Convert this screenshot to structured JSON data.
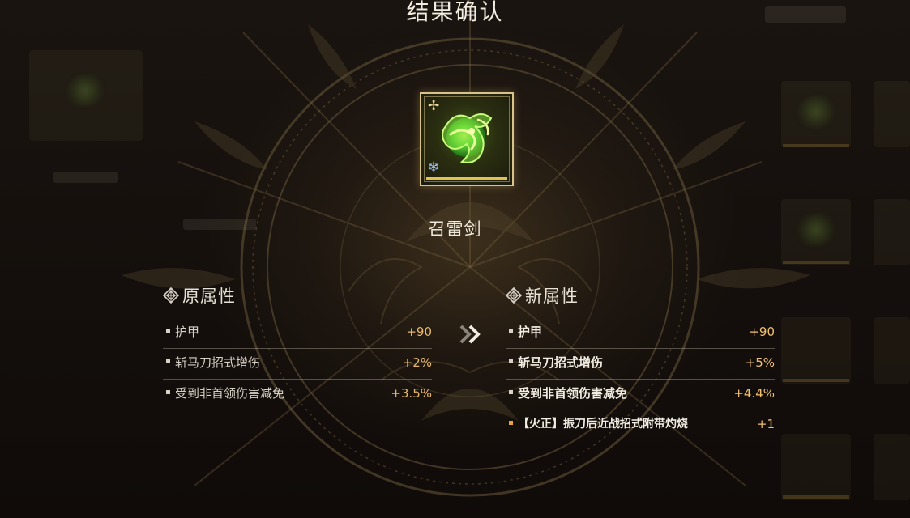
{
  "title": "结果确认",
  "item": {
    "name": "召雷剑",
    "icon": "green-serpent-gem-icon",
    "corner_top_left_icon": "cross-star-icon",
    "corner_bottom_left_icon": "snowflake-icon",
    "quality_color": "#e0c24e"
  },
  "old_attributes": {
    "title": "原属性",
    "icon": "diamond-ornament-icon",
    "rows": [
      {
        "label": "护甲",
        "value": "+90"
      },
      {
        "label": "斩马刀招式增伤",
        "value": "+2%"
      },
      {
        "label": "受到非首领伤害减免",
        "value": "+3.5%"
      }
    ]
  },
  "new_attributes": {
    "title": "新属性",
    "icon": "diamond-ornament-icon",
    "rows": [
      {
        "label": "护甲",
        "value": "+90"
      },
      {
        "label": "斩马刀招式增伤",
        "value": "+5%"
      },
      {
        "label": "受到非首领伤害减免",
        "value": "+4.4%"
      },
      {
        "label": "【火正】振刀后近战招式附带灼烧",
        "value": "+1"
      }
    ]
  },
  "arrow_icon": "double-chevron-right-icon",
  "colors": {
    "accent_gold": "#e8b86a",
    "special_orange": "#e9b060",
    "frame_gold": "#d8c48a"
  }
}
